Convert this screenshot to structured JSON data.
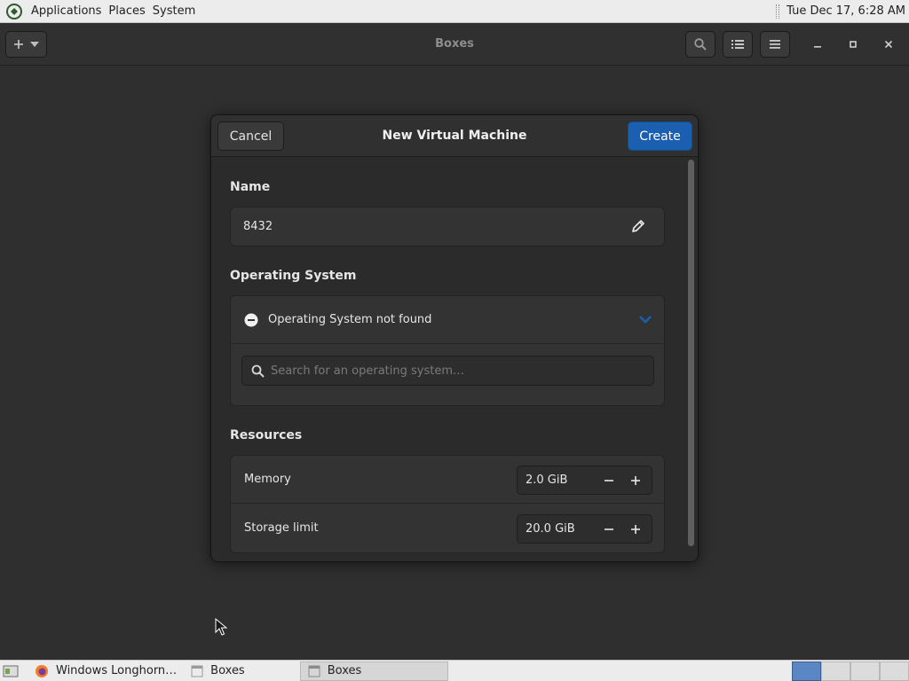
{
  "top_panel": {
    "menus": [
      "Applications",
      "Places",
      "System"
    ],
    "clock": "Tue Dec 17,  6:28 AM"
  },
  "headerbar": {
    "title": "Boxes",
    "icons": [
      "plus-icon",
      "chevron-down-icon",
      "search-icon",
      "list-view-icon",
      "menu-icon",
      "minimize-icon",
      "maximize-icon",
      "close-icon"
    ]
  },
  "dialog": {
    "title": "New Virtual Machine",
    "cancel_label": "Cancel",
    "create_label": "Create",
    "accent": "#1b5fb0",
    "name": {
      "heading": "Name",
      "value": "8432"
    },
    "os": {
      "heading": "Operating System",
      "status": "Operating System not found",
      "search_placeholder": "Search for an operating system…"
    },
    "resources": {
      "heading": "Resources",
      "memory": {
        "label": "Memory",
        "value": "2.0 GiB"
      },
      "storage": {
        "label": "Storage limit",
        "value": "20.0 GiB"
      }
    }
  },
  "taskbar": {
    "tasks": [
      {
        "label": "Windows Longhorn…",
        "icon": "firefox-icon"
      },
      {
        "label": "Boxes",
        "icon": "window-icon"
      },
      {
        "label": "Boxes",
        "icon": "window-icon"
      }
    ],
    "workspaces": 4,
    "active_workspace": 1
  }
}
